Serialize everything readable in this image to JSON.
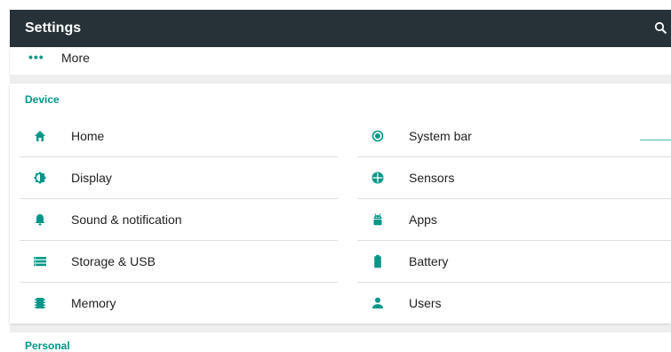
{
  "appbar": {
    "title": "Settings",
    "search_icon": "search-icon"
  },
  "wireless": {
    "more": {
      "label": "More",
      "icon": "more-horiz-icon"
    }
  },
  "device": {
    "title": "Device",
    "left": [
      {
        "label": "Home",
        "icon": "home-icon"
      },
      {
        "label": "Display",
        "icon": "brightness-icon"
      },
      {
        "label": "Sound & notification",
        "icon": "bell-icon"
      },
      {
        "label": "Storage & USB",
        "icon": "storage-icon"
      },
      {
        "label": "Memory",
        "icon": "memory-icon"
      }
    ],
    "right": [
      {
        "label": "System bar",
        "icon": "radio-icon"
      },
      {
        "label": "Sensors",
        "icon": "sensors-icon"
      },
      {
        "label": "Apps",
        "icon": "android-icon"
      },
      {
        "label": "Battery",
        "icon": "battery-icon"
      },
      {
        "label": "Users",
        "icon": "person-icon"
      }
    ]
  },
  "personal": {
    "title": "Personal"
  },
  "colors": {
    "accent": "#009688",
    "appbar": "#263238"
  }
}
